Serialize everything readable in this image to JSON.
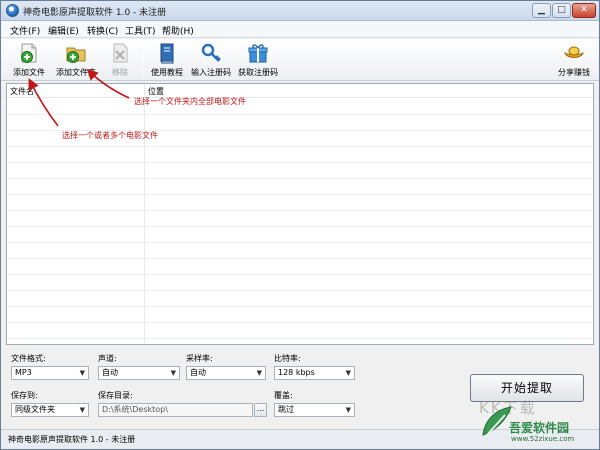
{
  "window": {
    "title": "神奇电影原声提取软件 1.0 - 未注册"
  },
  "menu": {
    "items": [
      "文件(F)",
      "编辑(E)",
      "转换(C)",
      "工具(T)",
      "帮助(H)"
    ]
  },
  "toolbar": {
    "add_file": "添加文件",
    "add_folder": "添加文件夹",
    "remove": "移除",
    "tutorial": "使用教程",
    "enter_code": "输入注册码",
    "get_code": "获取注册码",
    "share": "分享赚钱"
  },
  "list": {
    "col_filename": "文件名",
    "col_location": "位置"
  },
  "annotations": {
    "folder_hint": "选择一个文件夹内全部电影文件",
    "file_hint": "选择一个或者多个电影文件"
  },
  "settings": {
    "format_label": "文件格式:",
    "format_value": "MP3",
    "channel_label": "声道:",
    "channel_value": "自动",
    "samplerate_label": "采样率:",
    "samplerate_value": "自动",
    "bitrate_label": "比特率:",
    "bitrate_value": "128 kbps",
    "saveto_label": "保存到:",
    "saveto_value": "同级文件夹",
    "savedir_label": "保存目录:",
    "savedir_value": "D:\\系统\\Desktop\\",
    "browse_label": "...",
    "overwrite_label": "覆盖:",
    "overwrite_value": "跳过"
  },
  "actions": {
    "start": "开始提取"
  },
  "statusbar": {
    "text": "神奇电影原声提取软件 1.0 - 未注册"
  },
  "watermark": {
    "faint": "KK下载",
    "brand": "吾爱软件园",
    "url": "www.52zixue.com"
  },
  "colors": {
    "annotation": "#c01818",
    "watermark": "#2d8a4a"
  }
}
